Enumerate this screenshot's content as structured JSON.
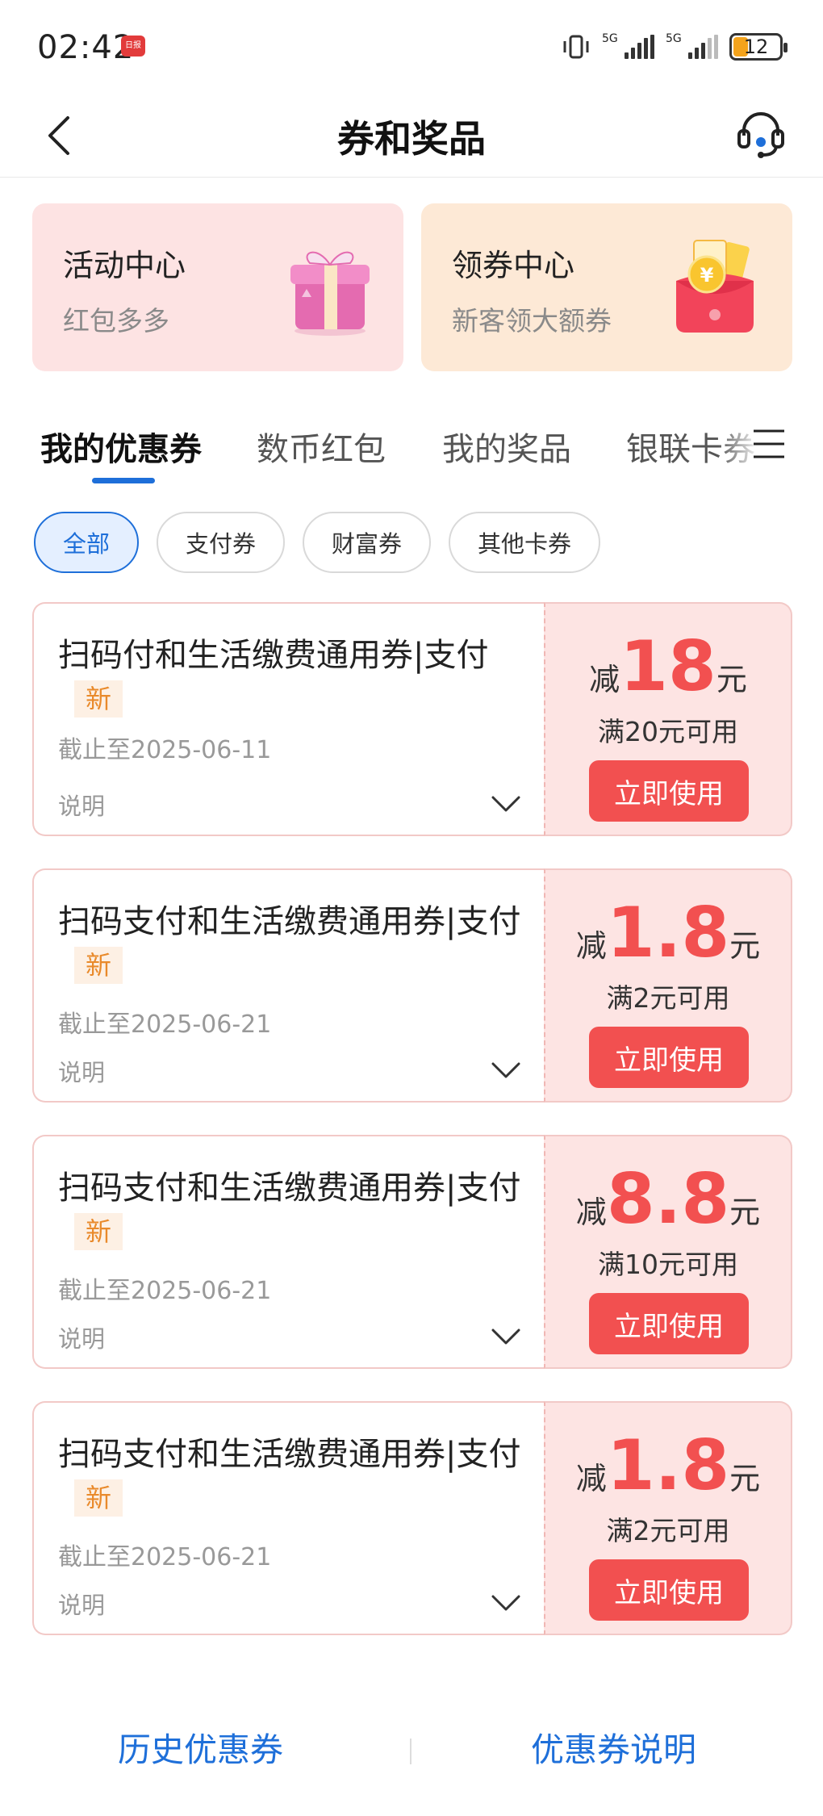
{
  "status": {
    "time": "02:42",
    "news_badge": "日报",
    "signal1_label": "5G",
    "signal2_label": "5G",
    "battery": "12"
  },
  "nav": {
    "title": "券和奖品"
  },
  "centers": [
    {
      "title": "活动中心",
      "subtitle": "红包多多"
    },
    {
      "title": "领券中心",
      "subtitle": "新客领大额券"
    }
  ],
  "tabs": [
    "我的优惠券",
    "数币红包",
    "我的奖品",
    "银联卡券"
  ],
  "chips": [
    "全部",
    "支付券",
    "财富券",
    "其他卡券"
  ],
  "coupons": [
    {
      "name": "扫码付和生活缴费通用券|支付",
      "tag": "新",
      "deadline": "截止至2025-06-11",
      "desc": "说明",
      "prefix": "减",
      "amount": "18",
      "unit": "元",
      "condition": "满20元可用",
      "button": "立即使用"
    },
    {
      "name": "扫码支付和生活缴费通用券|支付",
      "tag": "新",
      "deadline": "截止至2025-06-21",
      "desc": "说明",
      "prefix": "减",
      "amount": "1.8",
      "unit": "元",
      "condition": "满2元可用",
      "button": "立即使用"
    },
    {
      "name": "扫码支付和生活缴费通用券|支付",
      "tag": "新",
      "deadline": "截止至2025-06-21",
      "desc": "说明",
      "prefix": "减",
      "amount": "8.8",
      "unit": "元",
      "condition": "满10元可用",
      "button": "立即使用"
    },
    {
      "name": "扫码支付和生活缴费通用券|支付",
      "tag": "新",
      "deadline": "截止至2025-06-21",
      "desc": "说明",
      "prefix": "减",
      "amount": "1.8",
      "unit": "元",
      "condition": "满2元可用",
      "button": "立即使用"
    }
  ],
  "footer": {
    "history": "历史优惠券",
    "explain": "优惠券说明"
  },
  "colors": {
    "accent_blue": "#1e6fd9",
    "coupon_red": "#f25050",
    "new_tag_orange": "#e98a2b",
    "activity_bg": "#fde3e3",
    "coupon_center_bg": "#fde9d6"
  }
}
